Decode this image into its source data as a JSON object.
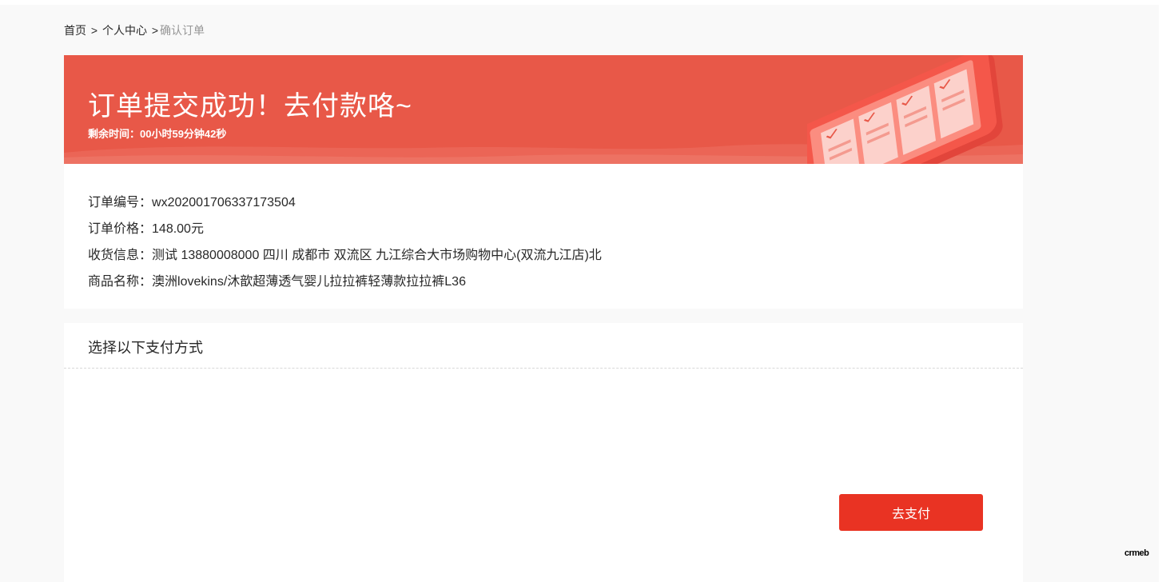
{
  "breadcrumb": {
    "home": "首页",
    "separator": ">",
    "center": "个人中心",
    "current": "确认订单"
  },
  "banner": {
    "title": "订单提交成功！去付款咯~",
    "timer_label": "剩余时间：",
    "timer_value": "00小时59分钟42秒",
    "color": "#e85848"
  },
  "order": {
    "number_label": "订单编号：",
    "number_value": "wx202001706337173504",
    "price_label": "订单价格：",
    "price_value": "148.00元",
    "address_label": "收货信息：",
    "address_value": "测试 13880008000 四川 成都市 双流区 九江综合大市场购物中心(双流九江店)北",
    "product_label": "商品名称：",
    "product_value": "澳洲lovekins/沐歆超薄透气婴儿拉拉裤轻薄款拉拉裤L36"
  },
  "payment": {
    "title": "选择以下支付方式",
    "button_label": "去支付",
    "button_color": "#e93323"
  },
  "corner_logo": {
    "text": "crmeb"
  },
  "icons": [
    "phone-illustration-icon"
  ]
}
